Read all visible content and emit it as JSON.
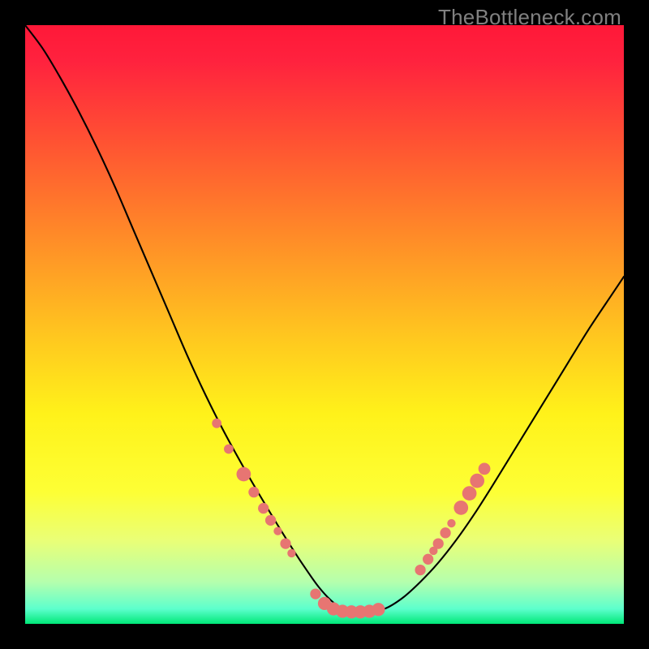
{
  "watermark": "TheBottleneck.com",
  "chart_data": {
    "type": "line",
    "title": "",
    "xlabel": "",
    "ylabel": "",
    "xlim": [
      0,
      100
    ],
    "ylim": [
      0,
      100
    ],
    "background_gradient_stops": [
      {
        "offset": 0.0,
        "color": "#ff1838"
      },
      {
        "offset": 0.06,
        "color": "#ff223e"
      },
      {
        "offset": 0.2,
        "color": "#ff5432"
      },
      {
        "offset": 0.35,
        "color": "#ff8a28"
      },
      {
        "offset": 0.52,
        "color": "#ffc71f"
      },
      {
        "offset": 0.65,
        "color": "#fff21a"
      },
      {
        "offset": 0.78,
        "color": "#fdff35"
      },
      {
        "offset": 0.86,
        "color": "#eaff76"
      },
      {
        "offset": 0.93,
        "color": "#b5ffad"
      },
      {
        "offset": 0.975,
        "color": "#5dffcd"
      },
      {
        "offset": 1.0,
        "color": "#00e878"
      }
    ],
    "series": [
      {
        "name": "bottleneck-curve",
        "x": [
          0.0,
          3.0,
          6.0,
          9.0,
          12.0,
          15.0,
          18.0,
          21.0,
          24.0,
          27.0,
          30.0,
          33.0,
          36.0,
          39.0,
          42.0,
          45.0,
          47.0,
          49.0,
          51.0,
          53.0,
          55.0,
          57.0,
          60.0,
          63.0,
          66.0,
          69.0,
          72.0,
          75.0,
          78.0,
          82.0,
          86.0,
          90.0,
          94.0,
          98.0,
          100.0
        ],
        "y": [
          100.0,
          96.0,
          91.0,
          85.5,
          79.5,
          73.0,
          66.0,
          59.0,
          52.0,
          45.0,
          38.5,
          32.5,
          27.0,
          21.8,
          16.8,
          12.0,
          9.0,
          6.2,
          4.0,
          2.5,
          2.0,
          2.0,
          2.5,
          4.3,
          7.0,
          10.2,
          14.0,
          18.3,
          23.0,
          29.5,
          36.0,
          42.5,
          49.0,
          55.0,
          58.0
        ]
      }
    ],
    "markers": [
      {
        "x": 32.0,
        "y": 33.5,
        "r": 0.8
      },
      {
        "x": 34.0,
        "y": 29.2,
        "r": 0.8
      },
      {
        "x": 36.5,
        "y": 25.0,
        "r": 1.2
      },
      {
        "x": 38.2,
        "y": 22.0,
        "r": 0.9
      },
      {
        "x": 39.8,
        "y": 19.3,
        "r": 0.9
      },
      {
        "x": 41.0,
        "y": 17.3,
        "r": 0.9
      },
      {
        "x": 42.2,
        "y": 15.5,
        "r": 0.7
      },
      {
        "x": 43.5,
        "y": 13.4,
        "r": 0.9
      },
      {
        "x": 44.5,
        "y": 11.8,
        "r": 0.7
      },
      {
        "x": 48.5,
        "y": 5.0,
        "r": 0.9
      },
      {
        "x": 50.0,
        "y": 3.4,
        "r": 1.1
      },
      {
        "x": 51.5,
        "y": 2.5,
        "r": 1.1
      },
      {
        "x": 53.0,
        "y": 2.1,
        "r": 1.1
      },
      {
        "x": 54.5,
        "y": 2.0,
        "r": 1.1
      },
      {
        "x": 56.0,
        "y": 2.0,
        "r": 1.1
      },
      {
        "x": 57.5,
        "y": 2.1,
        "r": 1.1
      },
      {
        "x": 59.0,
        "y": 2.4,
        "r": 1.1
      },
      {
        "x": 66.0,
        "y": 9.0,
        "r": 0.9
      },
      {
        "x": 67.3,
        "y": 10.8,
        "r": 0.9
      },
      {
        "x": 68.2,
        "y": 12.2,
        "r": 0.7
      },
      {
        "x": 69.0,
        "y": 13.4,
        "r": 0.9
      },
      {
        "x": 70.2,
        "y": 15.2,
        "r": 0.9
      },
      {
        "x": 71.2,
        "y": 16.8,
        "r": 0.7
      },
      {
        "x": 72.8,
        "y": 19.4,
        "r": 1.2
      },
      {
        "x": 74.2,
        "y": 21.8,
        "r": 1.2
      },
      {
        "x": 75.5,
        "y": 23.9,
        "r": 1.2
      },
      {
        "x": 76.7,
        "y": 25.9,
        "r": 1.0
      }
    ],
    "marker_color": "#e77572"
  }
}
